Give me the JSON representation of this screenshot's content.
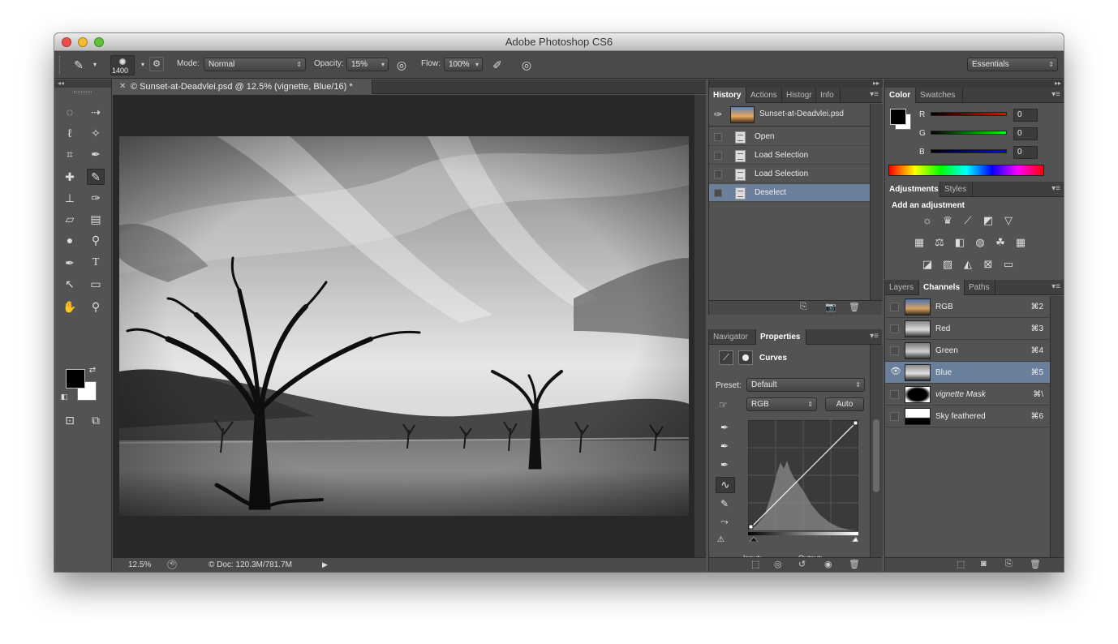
{
  "window": {
    "title": "Adobe Photoshop CS6"
  },
  "options_bar": {
    "brush_size": "1400",
    "mode_label": "Mode:",
    "mode_value": "Normal",
    "opacity_label": "Opacity:",
    "opacity_value": "15%",
    "flow_label": "Flow:",
    "flow_value": "100%",
    "workspace": "Essentials"
  },
  "document": {
    "tab_title": "© Sunset-at-Deadvlei.psd @ 12.5% (vignette, Blue/16) *",
    "zoom": "12.5%",
    "doc_size": "© Doc: 120.3M/781.7M"
  },
  "history_panel": {
    "tabs": [
      "History",
      "Actions",
      "Histogr",
      "Info"
    ],
    "snapshot": "Sunset-at-Deadvlei.psd",
    "items": [
      {
        "label": "Open",
        "selected": false
      },
      {
        "label": "Load Selection",
        "selected": false
      },
      {
        "label": "Load Selection",
        "selected": false
      },
      {
        "label": "Deselect",
        "selected": true
      }
    ]
  },
  "properties_panel": {
    "tabs": [
      "Navigator",
      "Properties"
    ],
    "title": "Curves",
    "preset_label": "Preset:",
    "preset_value": "Default",
    "channel_value": "RGB",
    "auto_label": "Auto",
    "input_label": "Input:",
    "output_label": "Output:"
  },
  "color_panel": {
    "tabs": [
      "Color",
      "Swatches"
    ],
    "r_label": "R",
    "g_label": "G",
    "b_label": "B",
    "r_value": "0",
    "g_value": "0",
    "b_value": "0"
  },
  "adjustments_panel": {
    "tabs": [
      "Adjustments",
      "Styles"
    ],
    "heading": "Add an adjustment"
  },
  "channels_panel": {
    "tabs": [
      "Layers",
      "Channels",
      "Paths"
    ],
    "rows": [
      {
        "name": "RGB",
        "shortcut": "⌘2",
        "visible": false,
        "selected": false
      },
      {
        "name": "Red",
        "shortcut": "⌘3",
        "visible": false,
        "selected": false
      },
      {
        "name": "Green",
        "shortcut": "⌘4",
        "visible": false,
        "selected": false
      },
      {
        "name": "Blue",
        "shortcut": "⌘5",
        "visible": true,
        "selected": true
      },
      {
        "name": "vignette Mask",
        "shortcut": "⌘\\",
        "visible": false,
        "selected": false
      },
      {
        "name": "Sky feathered",
        "shortcut": "⌘6",
        "visible": false,
        "selected": false
      }
    ]
  },
  "colors": {
    "selection_blue": "#6a7f9c",
    "panel_bg": "#535353",
    "canvas_bg": "#282828"
  }
}
